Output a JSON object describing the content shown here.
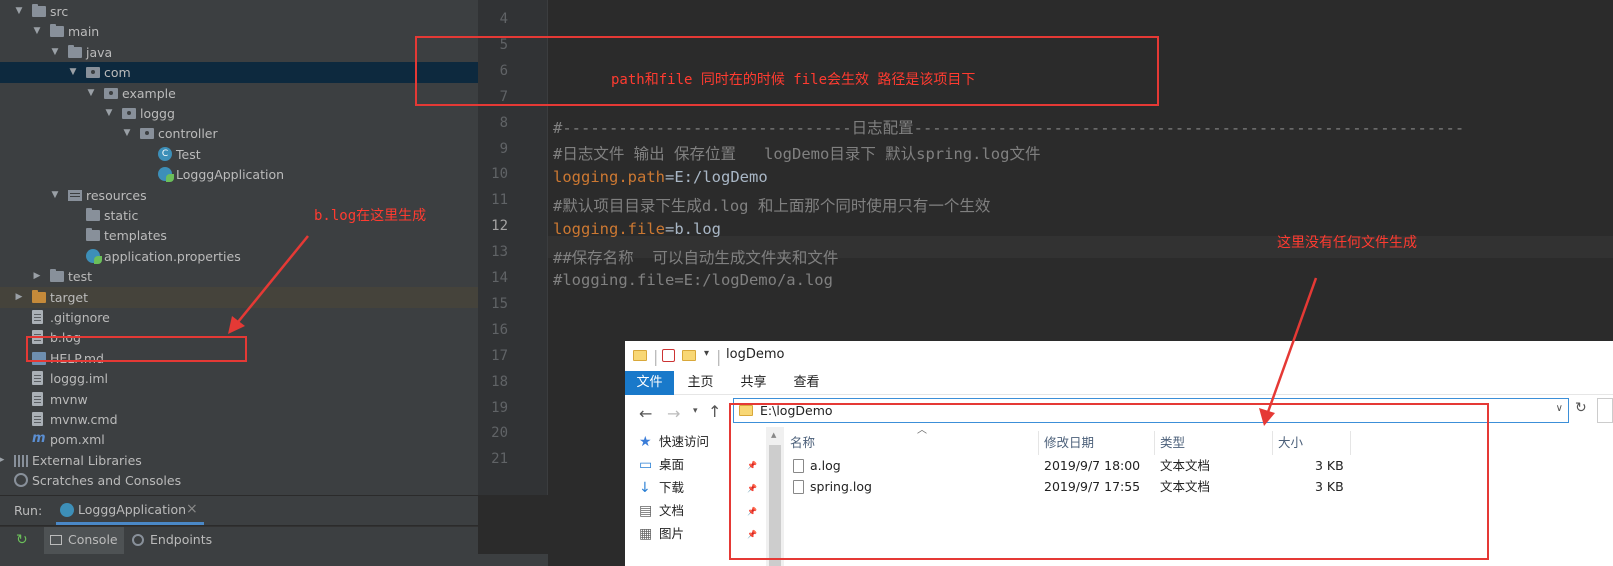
{
  "tree": [
    {
      "label": "src",
      "icon": "folder-icon",
      "arrow": "▼"
    },
    {
      "label": "main",
      "icon": "folder-icon",
      "arrow": "▼"
    },
    {
      "label": "java",
      "icon": "source-folder-icon",
      "arrow": "▼"
    },
    {
      "label": "com",
      "icon": "package-icon",
      "arrow": "▼",
      "selected": true
    },
    {
      "label": "example",
      "icon": "package-icon",
      "arrow": "▼"
    },
    {
      "label": "loggg",
      "icon": "package-icon",
      "arrow": "▼"
    },
    {
      "label": "controller",
      "icon": "package-icon",
      "arrow": "▼"
    },
    {
      "label": "Test",
      "icon": "class-icon"
    },
    {
      "label": "LogggApplication",
      "icon": "spring-boot-class-icon"
    },
    {
      "label": "resources",
      "icon": "resources-folder-icon",
      "arrow": "▼"
    },
    {
      "label": "static",
      "icon": "folder-icon"
    },
    {
      "label": "templates",
      "icon": "folder-icon"
    },
    {
      "label": "application.properties",
      "icon": "properties-file-icon"
    },
    {
      "label": "test",
      "icon": "folder-icon",
      "arrow": "▶"
    },
    {
      "label": "target",
      "icon": "excluded-folder-icon",
      "arrow": "▶",
      "dimmed": true
    },
    {
      "label": ".gitignore",
      "icon": "file-icon"
    },
    {
      "label": "b.log",
      "icon": "file-icon"
    },
    {
      "label": "HELP.md",
      "icon": "markdown-file-icon"
    },
    {
      "label": "loggg.iml",
      "icon": "module-file-icon"
    },
    {
      "label": "mvnw",
      "icon": "file-icon"
    },
    {
      "label": "mvnw.cmd",
      "icon": "file-icon"
    },
    {
      "label": "pom.xml",
      "icon": "maven-icon"
    },
    {
      "label": "External Libraries",
      "icon": "library-icon",
      "arrow": "▶"
    },
    {
      "label": "Scratches and Consoles",
      "icon": "scratch-icon"
    }
  ],
  "run": {
    "label": "Run:",
    "tab": "LogggApplication",
    "close": "×",
    "console": "Console",
    "endpoints": "Endpoints"
  },
  "editor": {
    "line_numbers": [
      "4",
      "5",
      "6",
      "7",
      "8",
      "9",
      "10",
      "11",
      "12",
      "13",
      "14",
      "15",
      "16",
      "17",
      "18",
      "19",
      "20",
      "21"
    ],
    "current_line": "12",
    "lines": [
      {
        "n": "8",
        "parts": [
          {
            "t": "#-------------------------------日志配置-----------------------------------------------------------",
            "c": "com"
          }
        ]
      },
      {
        "n": "9",
        "parts": [
          {
            "t": "#日志文件 输出 保存位置   logDemo目录下 默认spring.log文件",
            "c": "com"
          }
        ]
      },
      {
        "n": "10",
        "parts": [
          {
            "t": "logging.path",
            "c": "key"
          },
          {
            "t": "=",
            "c": "eq"
          },
          {
            "t": "E:/logDemo",
            "c": "val"
          }
        ]
      },
      {
        "n": "11",
        "parts": [
          {
            "t": "#默认项目目录下生成d.log 和上面那个同时使用只有一个生效",
            "c": "com"
          }
        ]
      },
      {
        "n": "12",
        "parts": [
          {
            "t": "logging.file",
            "c": "key"
          },
          {
            "t": "=",
            "c": "eq"
          },
          {
            "t": "b.log",
            "c": "val"
          }
        ]
      },
      {
        "n": "13",
        "parts": [
          {
            "t": "##保存名称  可以自动生成文件夹和文件",
            "c": "com"
          }
        ]
      },
      {
        "n": "14",
        "parts": [
          {
            "t": "#logging.file=E:/logDemo/a.log",
            "c": "com"
          }
        ]
      }
    ]
  },
  "annotations": {
    "note_top": "path和file  同时在的时候  file会生效 路径是该项目下",
    "note_blog": "b.log在这里生成",
    "note_right": "这里没有任何文件生成"
  },
  "explorer": {
    "title": "logDemo",
    "ribbon_tabs": [
      "文件",
      "主页",
      "共享",
      "查看"
    ],
    "address": "E:\\logDemo",
    "columns": [
      "名称",
      "修改日期",
      "类型",
      "大小"
    ],
    "files": [
      {
        "name": "a.log",
        "date": "2019/9/7 18:00",
        "type": "文本文档",
        "size": "3 KB"
      },
      {
        "name": "spring.log",
        "date": "2019/9/7 17:55",
        "type": "文本文档",
        "size": "3 KB"
      }
    ],
    "nav": [
      {
        "label": "快速访问",
        "icon": "star-icon"
      },
      {
        "label": "桌面",
        "icon": "desktop-icon"
      },
      {
        "label": "下载",
        "icon": "download-icon"
      },
      {
        "label": "文档",
        "icon": "document-icon"
      },
      {
        "label": "图片",
        "icon": "picture-icon"
      }
    ]
  },
  "colors": {
    "annotation": "#e53935",
    "ide_bg": "#2b2b2b",
    "tree_bg": "#3c3f41",
    "selection": "#0d293e",
    "explorer_accent": "#1979ca"
  }
}
